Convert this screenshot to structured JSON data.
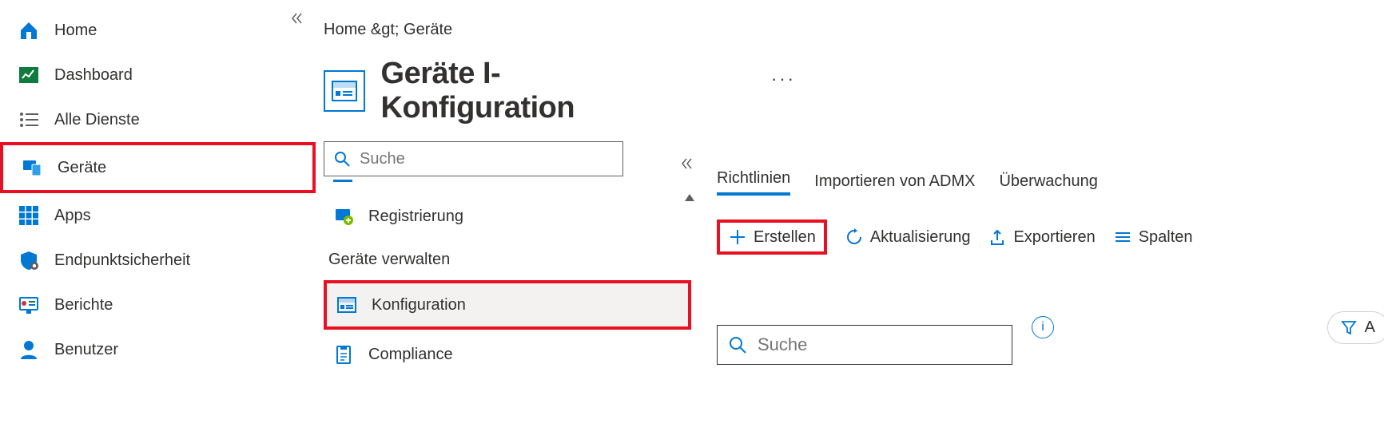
{
  "sidebar": {
    "items": [
      {
        "label": "Home"
      },
      {
        "label": "Dashboard"
      },
      {
        "label": "Alle Dienste"
      },
      {
        "label": "Geräte"
      },
      {
        "label": "Apps"
      },
      {
        "label": "Endpunktsicherheit"
      },
      {
        "label": "Berichte"
      },
      {
        "label": "Benutzer"
      }
    ]
  },
  "breadcrumb": "Home &gt;  Geräte",
  "page_title": "Geräte I-Konfiguration",
  "search_placeholder": "Suche",
  "mid_items": {
    "registration": "Registrierung",
    "section": "Geräte verwalten",
    "configuration": "Konfiguration",
    "compliance": "Compliance"
  },
  "tabs": [
    {
      "label": "Richtlinien",
      "active": true
    },
    {
      "label": "Importieren von ADMX"
    },
    {
      "label": "Überwachung"
    }
  ],
  "toolbar": {
    "create": "Erstellen",
    "refresh": "Aktualisierung",
    "export": "Exportieren",
    "columns": "Spalten"
  },
  "search2_placeholder": "Suche",
  "filter_label": "A"
}
